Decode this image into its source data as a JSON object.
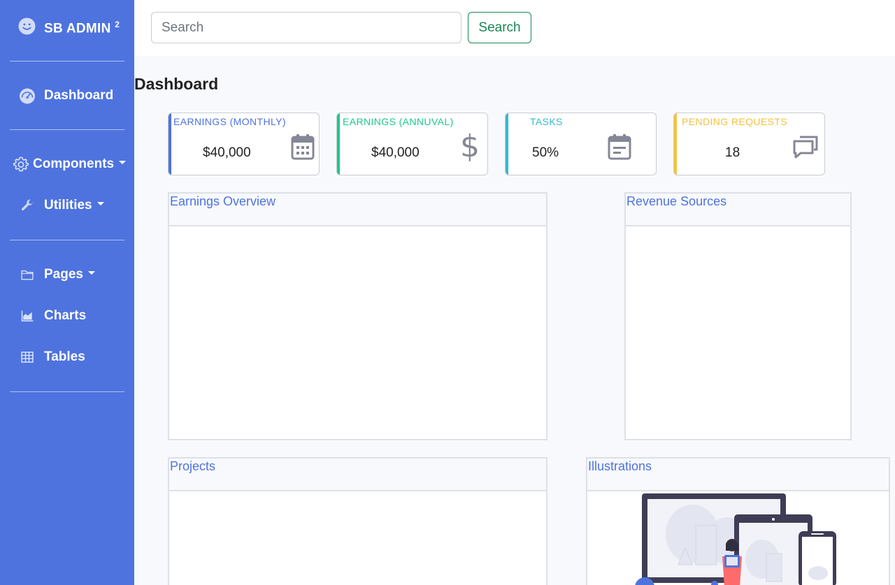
{
  "brand": {
    "name": "SB ADMIN",
    "sup": "2",
    "icon": "smile-icon"
  },
  "sidebar": {
    "items": [
      {
        "label": "Dashboard",
        "icon": "tachometer-icon",
        "dropdown": false
      },
      {
        "label": "Components",
        "icon": "gear-icon",
        "dropdown": true
      },
      {
        "label": "Utilities",
        "icon": "wrench-icon",
        "dropdown": true
      },
      {
        "label": "Pages",
        "icon": "folder-icon",
        "dropdown": true
      },
      {
        "label": "Charts",
        "icon": "area-chart-icon",
        "dropdown": false
      },
      {
        "label": "Tables",
        "icon": "table-icon",
        "dropdown": false
      }
    ]
  },
  "topbar": {
    "search_placeholder": "Search",
    "search_button": "Search"
  },
  "page": {
    "title": "Dashboard"
  },
  "stats": [
    {
      "label": "EARNINGS (MONTHLY)",
      "value": "$40,000",
      "icon": "calendar-icon",
      "color": "#4e73df"
    },
    {
      "label": "EARNINGS (ANNUVAL)",
      "value": "$40,000",
      "icon": "dollar-icon",
      "color": "#1cc88a"
    },
    {
      "label": "TASKS",
      "value": "50%",
      "icon": "clipboard-icon",
      "color": "#36b9cc"
    },
    {
      "label": "PENDING REQUESTS",
      "value": "18",
      "icon": "comments-icon",
      "color": "#f6c23e"
    }
  ],
  "panels": {
    "earnings_overview": "Earnings Overview",
    "revenue_sources": "Revenue Sources",
    "projects": "Projects",
    "illustrations": "Illustrations"
  },
  "colors": {
    "primary": "#4e73df",
    "success": "#198754",
    "gray_icon": "#858796",
    "page_bg": "#f8f9fc"
  }
}
